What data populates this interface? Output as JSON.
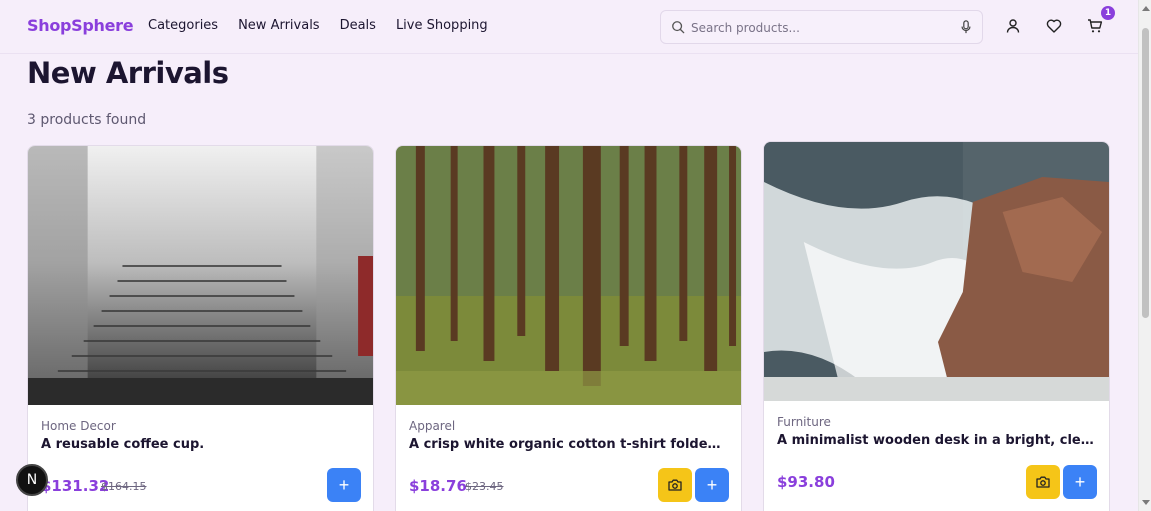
{
  "header": {
    "logo": "ShopSphere",
    "nav": [
      "Categories",
      "New Arrivals",
      "Deals",
      "Live Shopping"
    ],
    "search_placeholder": "Search products...",
    "cart_count": "1"
  },
  "page": {
    "title": "New Arrivals",
    "results": "3 products found"
  },
  "products": [
    {
      "category": "Home Decor",
      "name": "A reusable coffee cup.",
      "price": "$131.32",
      "old_price": "$164.15",
      "image": "foggy-stone-staircase",
      "has_camera": false
    },
    {
      "category": "Apparel",
      "name": "A crisp white organic cotton t-shirt folded neatly on a table.",
      "price": "$18.76",
      "old_price": "$23.45",
      "image": "pine-forest",
      "has_camera": true
    },
    {
      "category": "Furniture",
      "name": "A minimalist wooden desk in a bright, clean room.",
      "price": "$93.80",
      "old_price": "",
      "image": "waves-on-rocks",
      "has_camera": true
    }
  ],
  "dev_badge": "N",
  "colors": {
    "brand": "#8a3fdc",
    "add_button": "#3b82f6",
    "camera_button": "#f5c518",
    "background": "#f6eefa"
  }
}
